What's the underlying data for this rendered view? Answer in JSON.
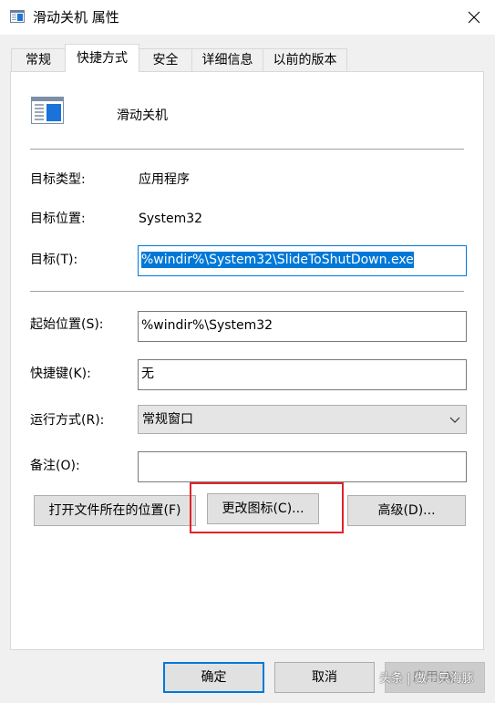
{
  "window": {
    "title": "滑动关机 属性",
    "close_glyph": "✕"
  },
  "tabs": [
    {
      "label": "常规",
      "active": false
    },
    {
      "label": "快捷方式",
      "active": true
    },
    {
      "label": "安全",
      "active": false
    },
    {
      "label": "详细信息",
      "active": false
    },
    {
      "label": "以前的版本",
      "active": false
    }
  ],
  "shortcut": {
    "name": "滑动关机",
    "target_type_label": "目标类型:",
    "target_type_value": "应用程序",
    "target_location_label": "目标位置:",
    "target_location_value": "System32",
    "target_label": "目标(T):",
    "target_value": "%windir%\\System32\\SlideToShutDown.exe",
    "start_in_label": "起始位置(S):",
    "start_in_value": "%windir%\\System32",
    "hotkey_label": "快捷键(K):",
    "hotkey_value": "无",
    "run_label": "运行方式(R):",
    "run_value": "常规窗口",
    "comment_label": "备注(O):",
    "comment_value": ""
  },
  "buttons": {
    "open_location": "打开文件所在的位置(F)",
    "change_icon": "更改图标(C)...",
    "advanced": "高级(D)...",
    "ok": "确定",
    "cancel": "取消",
    "apply": "应用(A)"
  },
  "watermark": "头条 | 做一只海豚",
  "colors": {
    "accent": "#0078d7",
    "highlight_box": "#e0242b",
    "panel_bg": "#ffffff",
    "window_bg": "#f0f0f0"
  },
  "icons": {
    "title": "shortcut-window-icon",
    "app": "app-window-icon",
    "close": "close-icon",
    "dropdown": "chevron-down-icon"
  }
}
